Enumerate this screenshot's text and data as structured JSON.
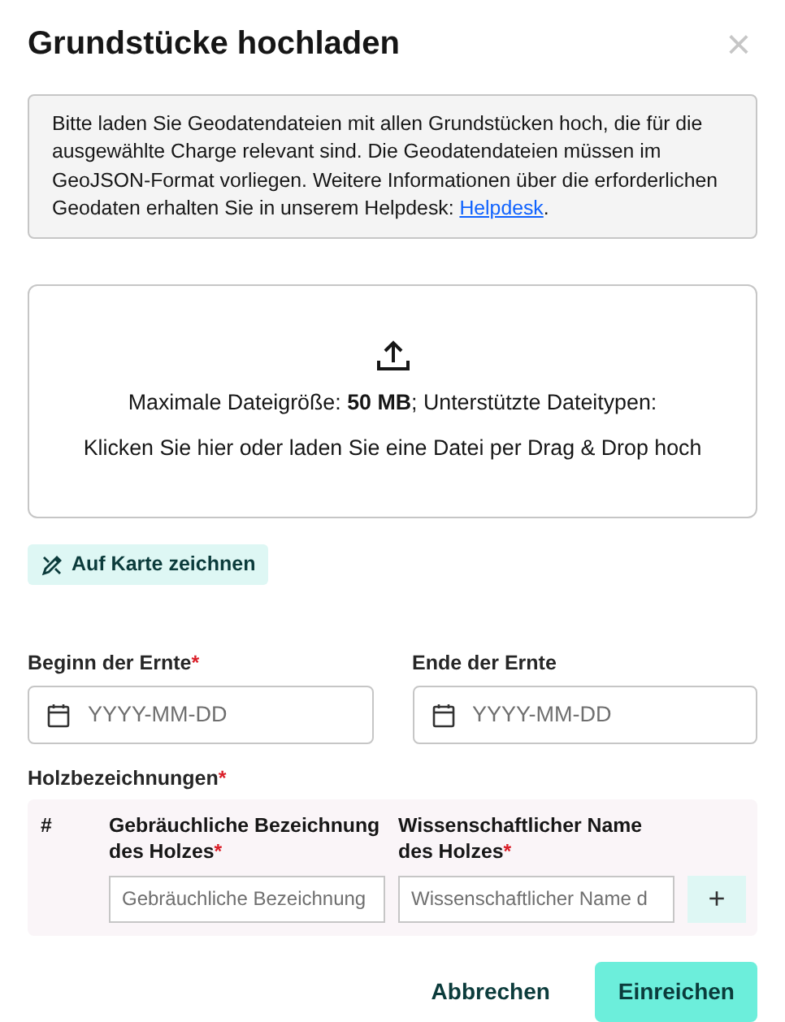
{
  "dialog": {
    "title": "Grundstücke hochladen",
    "close": "×"
  },
  "info": {
    "text": "Bitte laden Sie Geodatendateien mit allen Grundstücken hoch, die für die ausgewählte Charge relevant sind. Die Geodatendateien müssen im GeoJSON-Format vorliegen. Weitere Informationen über die erforderlichen Geodaten erhalten Sie in unserem Helpdesk:",
    "link": "Helpdesk",
    "end": "."
  },
  "dropzone": {
    "limits": "Maximale Dateigröße: **50 MB**; Unterstützte Dateitypen:",
    "hint": "Klicken Sie hier oder laden Sie eine Datei per Drag & Drop hoch"
  },
  "draw_button": "Auf Karte zeichnen",
  "dates": [
    {
      "label": "Beginn der Ernte",
      "required_mark": "*",
      "placeholder": "YYYY-MM-DD"
    },
    {
      "label": "Ende der Ernte",
      "placeholder": "YYYY-MM-DD"
    }
  ],
  "wood": {
    "label": "Holzbezeichnungen",
    "required_mark": "*",
    "columns": [
      {
        "label": "#"
      },
      {
        "label": "Gebräuchliche Bezeichnung des Holzes",
        "required_mark": "*",
        "placeholder": "Gebräuchliche Bezeichnung"
      },
      {
        "label": "Wissenschaftlicher Name des Holzes",
        "required_mark": "*",
        "placeholder": "Wissenschaftlicher Name d"
      }
    ],
    "add_button": "+"
  },
  "buttons": [
    {
      "label": "Abbrechen",
      "kind": "secondary"
    },
    {
      "label": "Einreichen",
      "kind": "primary"
    }
  ]
}
